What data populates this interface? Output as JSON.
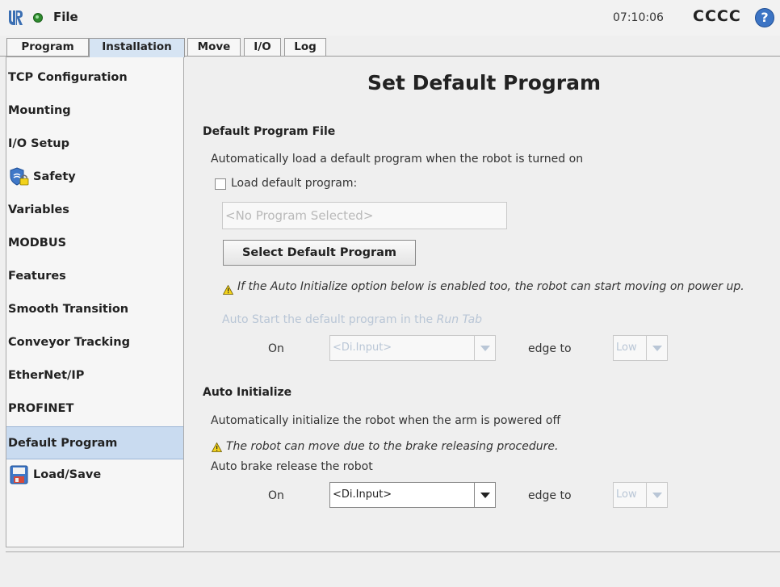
{
  "header": {
    "file_label": "File",
    "clock": "07:10:06",
    "robot_name": "CCCC",
    "help_glyph": "?",
    "status_color": "#2e8b2e"
  },
  "tabs": [
    {
      "label": "Program",
      "active": false
    },
    {
      "label": "Installation",
      "active": true
    },
    {
      "label": "Move",
      "active": false
    },
    {
      "label": "I/O",
      "active": false
    },
    {
      "label": "Log",
      "active": false
    }
  ],
  "sidebar": {
    "items": [
      {
        "label": "TCP Configuration"
      },
      {
        "label": "Mounting"
      },
      {
        "label": "I/O Setup"
      },
      {
        "label": "Safety",
        "icon": "safety-shield-lock-icon"
      },
      {
        "label": "Variables"
      },
      {
        "label": "MODBUS"
      },
      {
        "label": "Features"
      },
      {
        "label": "Smooth Transition"
      },
      {
        "label": "Conveyor Tracking"
      },
      {
        "label": "EtherNet/IP"
      },
      {
        "label": "PROFINET"
      },
      {
        "label": "Default Program",
        "selected": true
      },
      {
        "label": "Load/Save",
        "icon": "floppy-disk-icon"
      }
    ]
  },
  "main": {
    "title": "Set Default Program",
    "default_program": {
      "heading": "Default Program File",
      "description": "Automatically load a default program when the robot is turned on",
      "checkbox_label": "Load default program:",
      "checkbox_checked": false,
      "program_field": "<No Program Selected>",
      "select_button": "Select Default Program",
      "warning": "If the Auto Initialize option below is enabled too, the robot can start moving on power up.",
      "auto_start_prefix": "Auto Start the default program in the ",
      "auto_start_tab": "Run Tab",
      "on_label": "On",
      "input_value": "<Di.Input>",
      "edge_label": "edge to",
      "edge_value": "Low"
    },
    "auto_initialize": {
      "heading": "Auto Initialize",
      "description": "Automatically initialize the robot when the arm is powered off",
      "warning": "The robot can move due to the brake releasing procedure.",
      "brake_label": "Auto brake release the robot",
      "on_label": "On",
      "input_value": "<Di.Input>",
      "edge_label": "edge to",
      "edge_value": "Low"
    }
  },
  "colors": {
    "selected_bg": "#c9dbf0",
    "warning_yellow": "#f2d21b",
    "disabled_text": "#b9c6d6"
  }
}
